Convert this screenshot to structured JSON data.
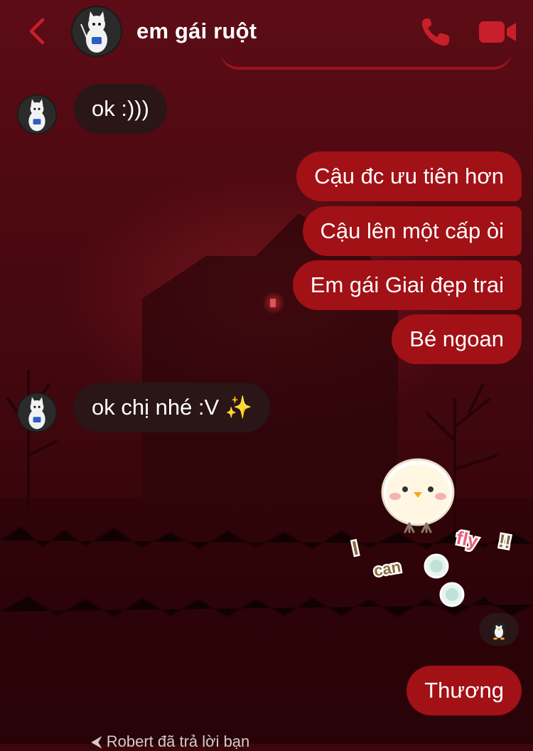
{
  "header": {
    "contact_name": "em gái ruột",
    "back_icon": "chevron-left-icon",
    "call_icon": "phone-icon",
    "video_icon": "video-camera-icon",
    "accent_color": "#c8202a"
  },
  "messages": [
    {
      "from": "contact",
      "text": "ok :)))"
    },
    {
      "from": "me",
      "text": "Cậu đc ưu tiên hơn"
    },
    {
      "from": "me",
      "text": "Cậu lên một cấp òi"
    },
    {
      "from": "me",
      "text": "Em gái Giai đẹp trai"
    },
    {
      "from": "me",
      "text": "Bé ngoan"
    },
    {
      "from": "contact",
      "text": "ok chị nhé :V ✨"
    },
    {
      "from": "me",
      "type": "sticker",
      "sticker": {
        "words": [
          "I",
          "can",
          "fly",
          "!!"
        ]
      },
      "reaction_icon": "penguin-icon"
    },
    {
      "from": "me",
      "text": "Thương"
    }
  ],
  "reply_note": "Robert đã trả lời bạn",
  "colors": {
    "outgoing_bubble": "#a11116",
    "incoming_bubble": "#2a1517",
    "background": "#4b0910"
  }
}
